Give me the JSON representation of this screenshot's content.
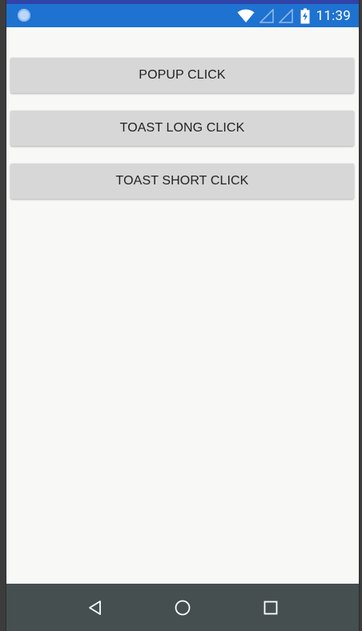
{
  "status_bar": {
    "time": "11:39",
    "icons": [
      "notification-dot-icon",
      "wifi-icon",
      "signal-icon",
      "signal-icon",
      "battery-charging-icon"
    ]
  },
  "buttons": {
    "popup": "POPUP CLICK",
    "toast_long": "TOAST LONG CLICK",
    "toast_short": "TOAST SHORT CLICK"
  },
  "nav_bar": {
    "icons": [
      "back-icon",
      "home-icon",
      "recent-apps-icon"
    ]
  },
  "colors": {
    "status_bar": "#1e72d0",
    "background": "#f8f8f7",
    "button": "#d6d7d6",
    "nav_bar": "#454f4f"
  }
}
